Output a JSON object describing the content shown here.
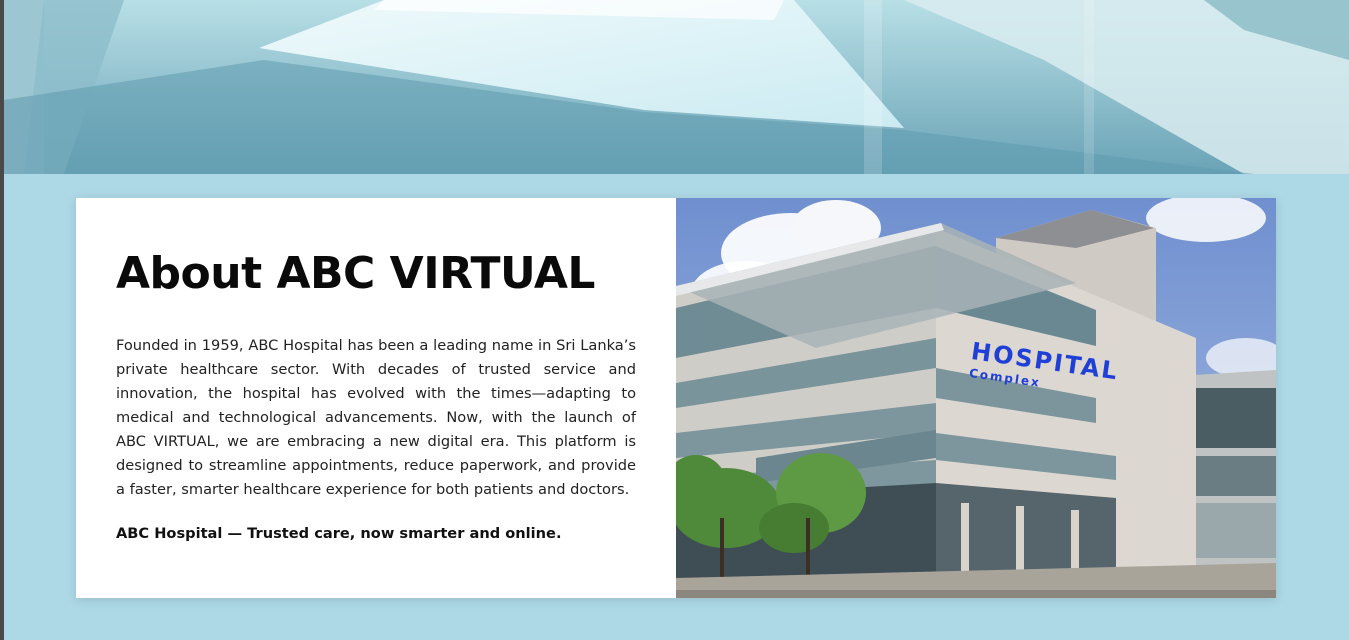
{
  "about": {
    "title": "About ABC VIRTUAL",
    "description": "Founded in 1959, ABC Hospital has been a leading name in Sri Lanka’s private healthcare sector. With decades of trusted service and innovation, the hospital has evolved with the times—adapting to medical and technological advancements. Now, with the launch of ABC VIRTUAL, we are embracing a new digital era. This platform is designed to streamline appointments, reduce paperwork, and provide a faster, smarter healthcare experience for both patients and doctors.",
    "tagline": "ABC Hospital — Trusted care, now smarter and online."
  },
  "photo": {
    "sign_main": "HOSPITAL",
    "sign_sub": "Complex"
  },
  "colors": {
    "section_background": "#add8e6",
    "card_background": "#ffffff",
    "title_color": "#0a0a0a",
    "sign_color": "#1f3fd6"
  }
}
